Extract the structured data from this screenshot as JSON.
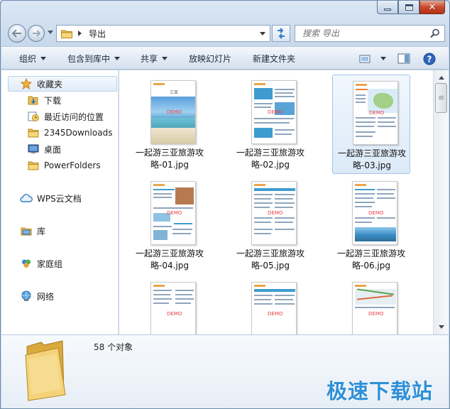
{
  "window": {
    "caption": {
      "minimize": "minimize",
      "maximize": "maximize",
      "close": "close"
    }
  },
  "nav": {
    "address_segment": "导出",
    "search_placeholder": "搜索 导出"
  },
  "toolbar": {
    "organize": "组织",
    "include_in_library": "包含到库中",
    "share": "共享",
    "slideshow": "放映幻灯片",
    "new_folder": "新建文件夹"
  },
  "sidebar": {
    "favorites": "收藏夹",
    "items": [
      {
        "label": "下载",
        "icon": "download-folder-icon"
      },
      {
        "label": "最近访问的位置",
        "icon": "recent-places-icon"
      },
      {
        "label": "2345Downloads",
        "icon": "folder-icon"
      },
      {
        "label": "桌面",
        "icon": "desktop-icon"
      },
      {
        "label": "PowerFolders",
        "icon": "folder-icon"
      }
    ],
    "wps_cloud": "WPS云文档",
    "libraries": "库",
    "homegroup": "家庭组",
    "network": "网络"
  },
  "files": [
    {
      "name_line1": "一起游三亚旅游攻",
      "name_line2": "略-01.jpg"
    },
    {
      "name_line1": "一起游三亚旅游攻",
      "name_line2": "略-02.jpg"
    },
    {
      "name_line1": "一起游三亚旅游攻",
      "name_line2": "略-03.jpg",
      "selected": true
    },
    {
      "name_line1": "一起游三亚旅游攻",
      "name_line2": "略-04.jpg"
    },
    {
      "name_line1": "一起游三亚旅游攻",
      "name_line2": "略-05.jpg"
    },
    {
      "name_line1": "一起游三亚旅游攻",
      "name_line2": "略-06.jpg"
    },
    {
      "name_line1": "",
      "name_line2": ""
    },
    {
      "name_line1": "",
      "name_line2": ""
    },
    {
      "name_line1": "",
      "name_line2": ""
    }
  ],
  "thumb_demo_text": "DEMO",
  "thumb_cover_text": "三亚",
  "details": {
    "count": "58 个对象"
  },
  "watermark": "极速下载站",
  "colors": {
    "accent": "#2f8fd8",
    "close": "#c8492c",
    "folder": "#e8c15a"
  }
}
